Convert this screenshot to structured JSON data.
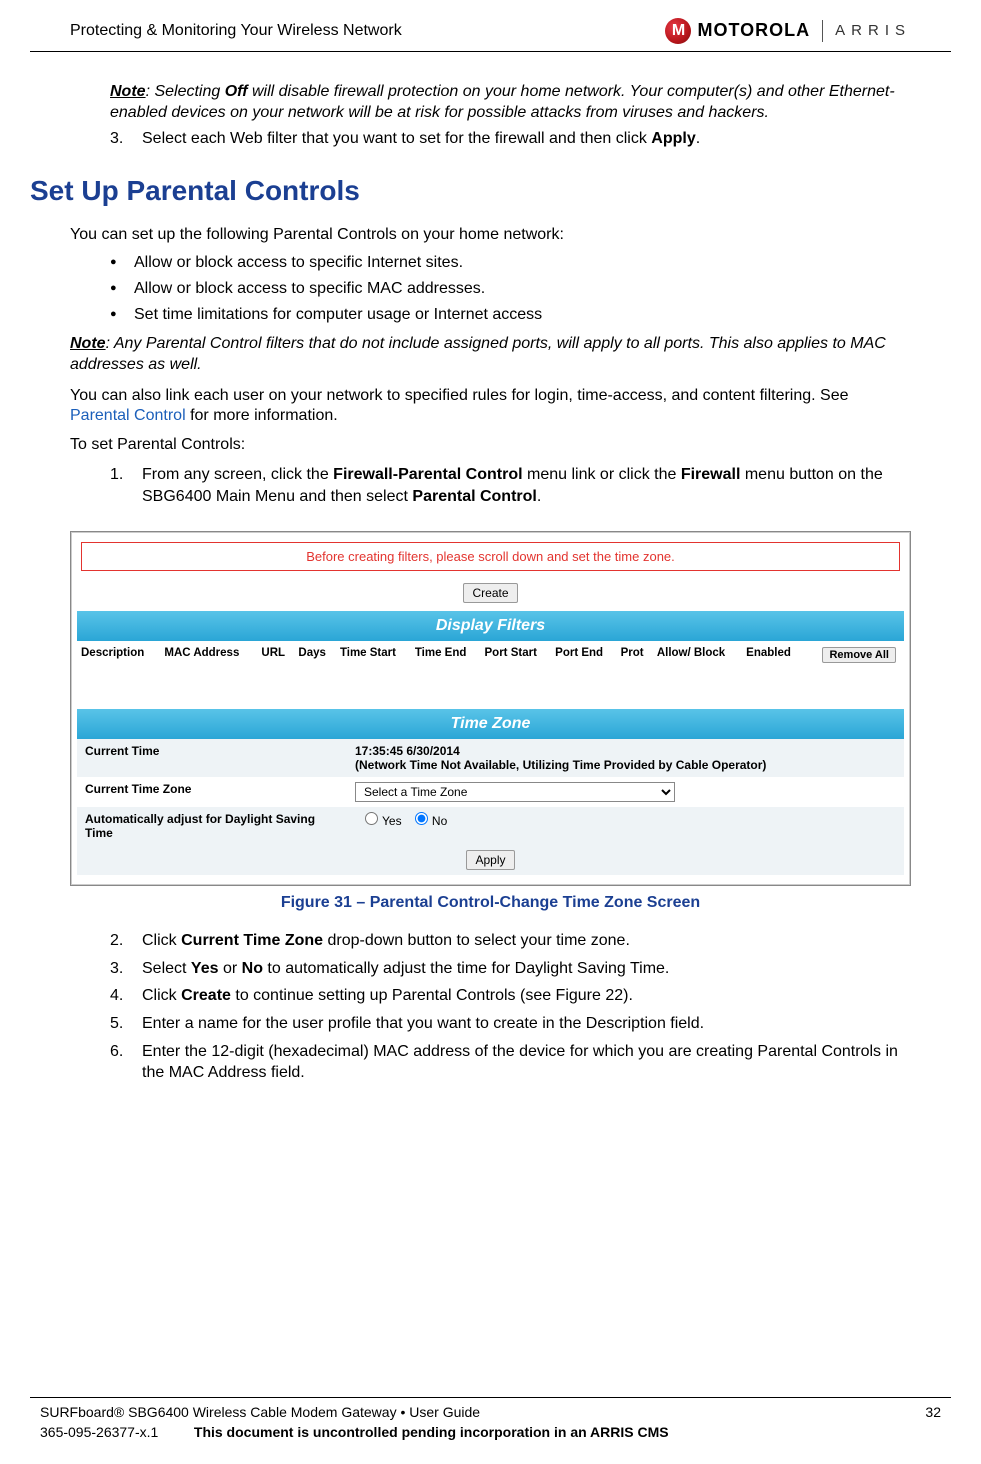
{
  "header": {
    "title": "Protecting & Monitoring Your Wireless Network",
    "brand_motorola": "MOTOROLA",
    "brand_arris": "ARRIS",
    "moto_badge_letter": "M"
  },
  "intro_note": {
    "prefix": "Note",
    "body_a": ": Selecting ",
    "off": "Off",
    "body_b": " will disable firewall protection on your home network. Your computer(s) and other Ethernet-enabled devices on your network will be at risk for possible attacks from viruses and hackers."
  },
  "step3": {
    "num": "3.",
    "text_a": "Select each Web filter that you want to set for the firewall and then click ",
    "apply": "Apply",
    "text_b": "."
  },
  "section_heading": "Set Up Parental Controls",
  "pc_intro": "You can set up the following Parental Controls on your home network:",
  "bullets": [
    "Allow or block access to specific Internet sites.",
    "Allow or block access to specific MAC addresses.",
    "Set time limitations for computer usage or Internet access"
  ],
  "note2": {
    "prefix": "Note",
    "body": ": Any Parental Control filters that do not include assigned ports, will apply to all ports. This also applies to MAC addresses as well."
  },
  "link_para": {
    "a": "You can also link each user on your network to specified rules for login, time-access, and content filtering. See ",
    "link": "Parental Control",
    "b": " for more information."
  },
  "to_set": "To set Parental Controls:",
  "step1": {
    "num": "1.",
    "a": "From any screen, click the ",
    "b": "Firewall-Parental Control",
    "c": " menu link or click the ",
    "d": "Firewall",
    "e": " menu button on the SBG6400 Main Menu and then select ",
    "f": "Parental Control",
    "g": "."
  },
  "figure": {
    "warn": "Before creating filters, please scroll down and set the time zone.",
    "create_btn": "Create",
    "display_filters": "Display Filters",
    "cols": {
      "desc": "Description",
      "mac": "MAC Address",
      "url": "URL",
      "days": "Days",
      "tstart": "Time Start",
      "tend": "Time End",
      "pstart": "Port Start",
      "pend": "Port End",
      "prot": "Prot",
      "allow": "Allow/ Block",
      "enabled": "Enabled"
    },
    "remove_all": "Remove All",
    "time_zone_hdr": "Time Zone",
    "tz_rows": {
      "current_time_lbl": "Current Time",
      "current_time_val": "17:35:45 6/30/2014",
      "current_time_note": "(Network Time Not Available, Utilizing Time Provided by Cable Operator)",
      "ctz_lbl": "Current Time Zone",
      "ctz_select": "Select a Time Zone",
      "dst_lbl": "Automatically adjust for Daylight Saving Time",
      "yes": "Yes",
      "no": "No"
    },
    "apply_btn": "Apply",
    "caption": "Figure 31 – Parental Control-Change Time Zone Screen"
  },
  "steps_after": [
    {
      "num": "2.",
      "a": "Click ",
      "b": "Current Time Zone",
      "c": " drop-down button to select your time zone."
    },
    {
      "num": "3.",
      "a": "Select ",
      "b": "Yes",
      "c": " or ",
      "d": "No",
      "e": " to automatically adjust the time for Daylight Saving Time."
    },
    {
      "num": "4.",
      "a": "Click ",
      "b": "Create",
      "c": " to continue setting up Parental Controls (see Figure 22)."
    },
    {
      "num": "5.",
      "a": "Enter a name for the user profile that you want to create in the Description field."
    },
    {
      "num": "6.",
      "a": "Enter the 12-digit (hexadecimal) MAC address of the device for which you are creating Parental Controls in the MAC Address field."
    }
  ],
  "footer": {
    "product": "SURFboard® SBG6400 Wireless Cable Modem Gateway • User Guide",
    "page": "32",
    "docnum": "365-095-26377-x.1",
    "notice": "This document is uncontrolled pending incorporation in an ARRIS CMS"
  }
}
